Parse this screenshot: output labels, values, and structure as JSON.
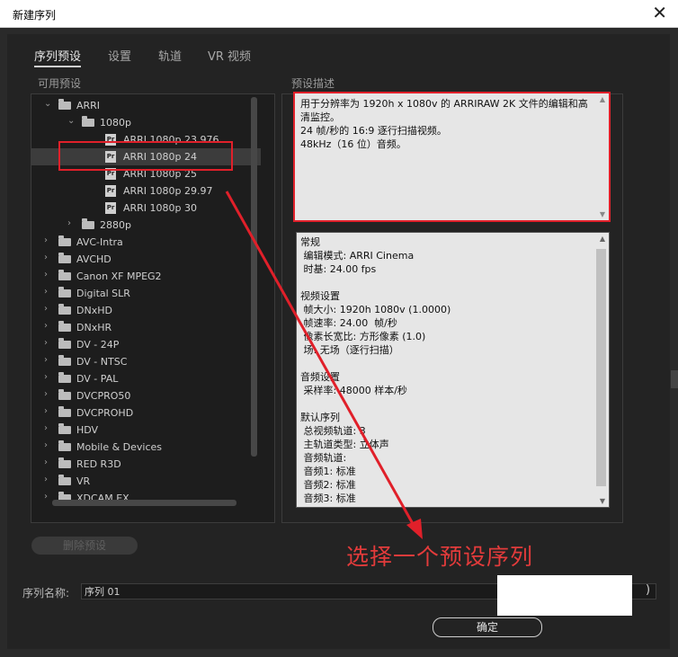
{
  "window": {
    "title": "新建序列",
    "close_glyph": "✕"
  },
  "tabs": [
    "序列预设",
    "设置",
    "轨道",
    "VR 视频"
  ],
  "available_presets_label": "可用预设",
  "preset_description_label": "预设描述",
  "tree": [
    {
      "level": 0,
      "expanded": true,
      "type": "folder",
      "label": "ARRI"
    },
    {
      "level": 1,
      "expanded": true,
      "type": "folder",
      "label": "1080p"
    },
    {
      "level": 2,
      "type": "preset",
      "label": "ARRI 1080p 23.976"
    },
    {
      "level": 2,
      "type": "preset",
      "label": "ARRI 1080p 24",
      "selected": true
    },
    {
      "level": 2,
      "type": "preset",
      "label": "ARRI 1080p 25"
    },
    {
      "level": 2,
      "type": "preset",
      "label": "ARRI 1080p 29.97"
    },
    {
      "level": 2,
      "type": "preset",
      "label": "ARRI 1080p 30"
    },
    {
      "level": 1,
      "expanded": false,
      "type": "folder",
      "label": "2880p"
    },
    {
      "level": 0,
      "expanded": false,
      "type": "folder",
      "label": "AVC-Intra"
    },
    {
      "level": 0,
      "expanded": false,
      "type": "folder",
      "label": "AVCHD"
    },
    {
      "level": 0,
      "expanded": false,
      "type": "folder",
      "label": "Canon XF MPEG2"
    },
    {
      "level": 0,
      "expanded": false,
      "type": "folder",
      "label": "Digital SLR"
    },
    {
      "level": 0,
      "expanded": false,
      "type": "folder",
      "label": "DNxHD"
    },
    {
      "level": 0,
      "expanded": false,
      "type": "folder",
      "label": "DNxHR"
    },
    {
      "level": 0,
      "expanded": false,
      "type": "folder",
      "label": "DV - 24P"
    },
    {
      "level": 0,
      "expanded": false,
      "type": "folder",
      "label": "DV - NTSC"
    },
    {
      "level": 0,
      "expanded": false,
      "type": "folder",
      "label": "DV - PAL"
    },
    {
      "level": 0,
      "expanded": false,
      "type": "folder",
      "label": "DVCPRO50"
    },
    {
      "level": 0,
      "expanded": false,
      "type": "folder",
      "label": "DVCPROHD"
    },
    {
      "level": 0,
      "expanded": false,
      "type": "folder",
      "label": "HDV"
    },
    {
      "level": 0,
      "expanded": false,
      "type": "folder",
      "label": "Mobile & Devices"
    },
    {
      "level": 0,
      "expanded": false,
      "type": "folder",
      "label": "RED R3D"
    },
    {
      "level": 0,
      "expanded": false,
      "type": "folder",
      "label": "VR"
    },
    {
      "level": 0,
      "expanded": false,
      "type": "folder",
      "label": "XDCAM EX"
    }
  ],
  "description": [
    "用于分辨率为 1920h x 1080v 的 ARRIRAW 2K 文件的编辑和高清监控。",
    "24 帧/秒的 16:9 逐行扫描视频。",
    "48kHz（16 位）音频。"
  ],
  "info_lines": [
    "常规",
    " 编辑模式: ARRI Cinema",
    " 时基: 24.00 fps",
    "",
    "视频设置",
    " 帧大小: 1920h 1080v (1.0000)",
    " 帧速率: 24.00  帧/秒",
    " 像素长宽比: 方形像素 (1.0)",
    " 场: 无场（逐行扫描）",
    "",
    "音频设置",
    " 采样率: 48000 样本/秒",
    "",
    "默认序列",
    " 总视频轨道: 3",
    " 主轨道类型: 立体声",
    " 音频轨道:",
    " 音频1: 标准",
    " 音频2: 标准",
    " 音频3: 标准"
  ],
  "delete_preset_label": "删除预设",
  "sequence_name_label": "序列名称:",
  "sequence_name_value": "序列 01",
  "ok_label": "确定",
  "annotation_text": "选择一个预设序列",
  "colors": {
    "annotation_red": "#e0202a",
    "background": "#232323"
  }
}
